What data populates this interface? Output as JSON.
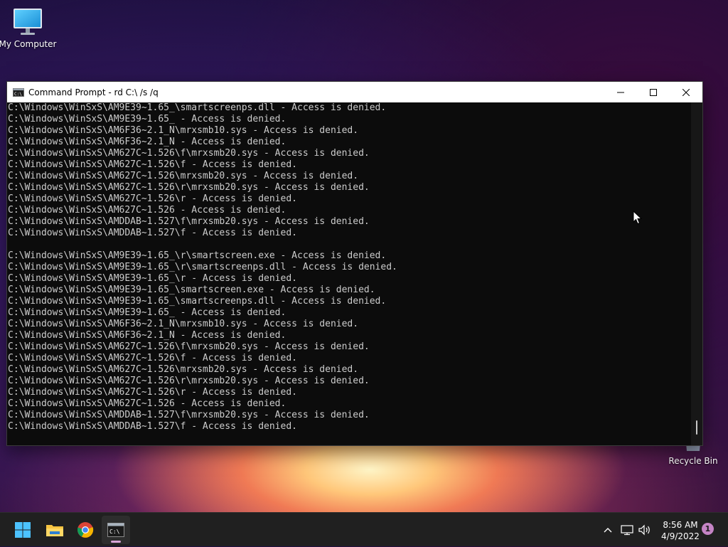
{
  "desktop": {
    "icons": [
      {
        "label": "My Computer"
      },
      {
        "label": "Recycle Bin"
      }
    ]
  },
  "window": {
    "title": "Command Prompt - rd  C:\\ /s /q",
    "controls": {
      "minimize": "minimize-icon",
      "maximize": "maximize-icon",
      "close": "close-icon"
    }
  },
  "console": {
    "lines": [
      "C:\\Windows\\WinSxS\\AM9E39~1.65_\\smartscreenps.dll - Access is denied.",
      "C:\\Windows\\WinSxS\\AM9E39~1.65_ - Access is denied.",
      "C:\\Windows\\WinSxS\\AM6F36~2.1_N\\mrxsmb10.sys - Access is denied.",
      "C:\\Windows\\WinSxS\\AM6F36~2.1_N - Access is denied.",
      "C:\\Windows\\WinSxS\\AM627C~1.526\\f\\mrxsmb20.sys - Access is denied.",
      "C:\\Windows\\WinSxS\\AM627C~1.526\\f - Access is denied.",
      "C:\\Windows\\WinSxS\\AM627C~1.526\\mrxsmb20.sys - Access is denied.",
      "C:\\Windows\\WinSxS\\AM627C~1.526\\r\\mrxsmb20.sys - Access is denied.",
      "C:\\Windows\\WinSxS\\AM627C~1.526\\r - Access is denied.",
      "C:\\Windows\\WinSxS\\AM627C~1.526 - Access is denied.",
      "C:\\Windows\\WinSxS\\AMDDAB~1.527\\f\\mrxsmb20.sys - Access is denied.",
      "C:\\Windows\\WinSxS\\AMDDAB~1.527\\f - Access is denied.",
      "",
      "C:\\Windows\\WinSxS\\AM9E39~1.65_\\r\\smartscreen.exe - Access is denied.",
      "C:\\Windows\\WinSxS\\AM9E39~1.65_\\r\\smartscreenps.dll - Access is denied.",
      "C:\\Windows\\WinSxS\\AM9E39~1.65_\\r - Access is denied.",
      "C:\\Windows\\WinSxS\\AM9E39~1.65_\\smartscreen.exe - Access is denied.",
      "C:\\Windows\\WinSxS\\AM9E39~1.65_\\smartscreenps.dll - Access is denied.",
      "C:\\Windows\\WinSxS\\AM9E39~1.65_ - Access is denied.",
      "C:\\Windows\\WinSxS\\AM6F36~2.1_N\\mrxsmb10.sys - Access is denied.",
      "C:\\Windows\\WinSxS\\AM6F36~2.1_N - Access is denied.",
      "C:\\Windows\\WinSxS\\AM627C~1.526\\f\\mrxsmb20.sys - Access is denied.",
      "C:\\Windows\\WinSxS\\AM627C~1.526\\f - Access is denied.",
      "C:\\Windows\\WinSxS\\AM627C~1.526\\mrxsmb20.sys - Access is denied.",
      "C:\\Windows\\WinSxS\\AM627C~1.526\\r\\mrxsmb20.sys - Access is denied.",
      "C:\\Windows\\WinSxS\\AM627C~1.526\\r - Access is denied.",
      "C:\\Windows\\WinSxS\\AM627C~1.526 - Access is denied.",
      "C:\\Windows\\WinSxS\\AMDDAB~1.527\\f\\mrxsmb20.sys - Access is denied.",
      "C:\\Windows\\WinSxS\\AMDDAB~1.527\\f - Access is denied."
    ]
  },
  "taskbar": {
    "apps": [
      {
        "name": "start-button",
        "icon": "windows-logo-icon"
      },
      {
        "name": "file-explorer",
        "icon": "folder-icon"
      },
      {
        "name": "chrome",
        "icon": "chrome-icon"
      },
      {
        "name": "command-prompt",
        "icon": "terminal-icon",
        "active": true
      }
    ],
    "tray": {
      "icons": [
        "chevron-up-icon",
        "network-icon",
        "volume-icon"
      ],
      "time": "8:56 AM",
      "date": "4/9/2022",
      "notifications": "1"
    }
  },
  "colors": {
    "console_bg": "#0c0c0c",
    "console_text": "#cccccc",
    "taskbar_bg": "#202020",
    "accent": "#c584c5"
  }
}
